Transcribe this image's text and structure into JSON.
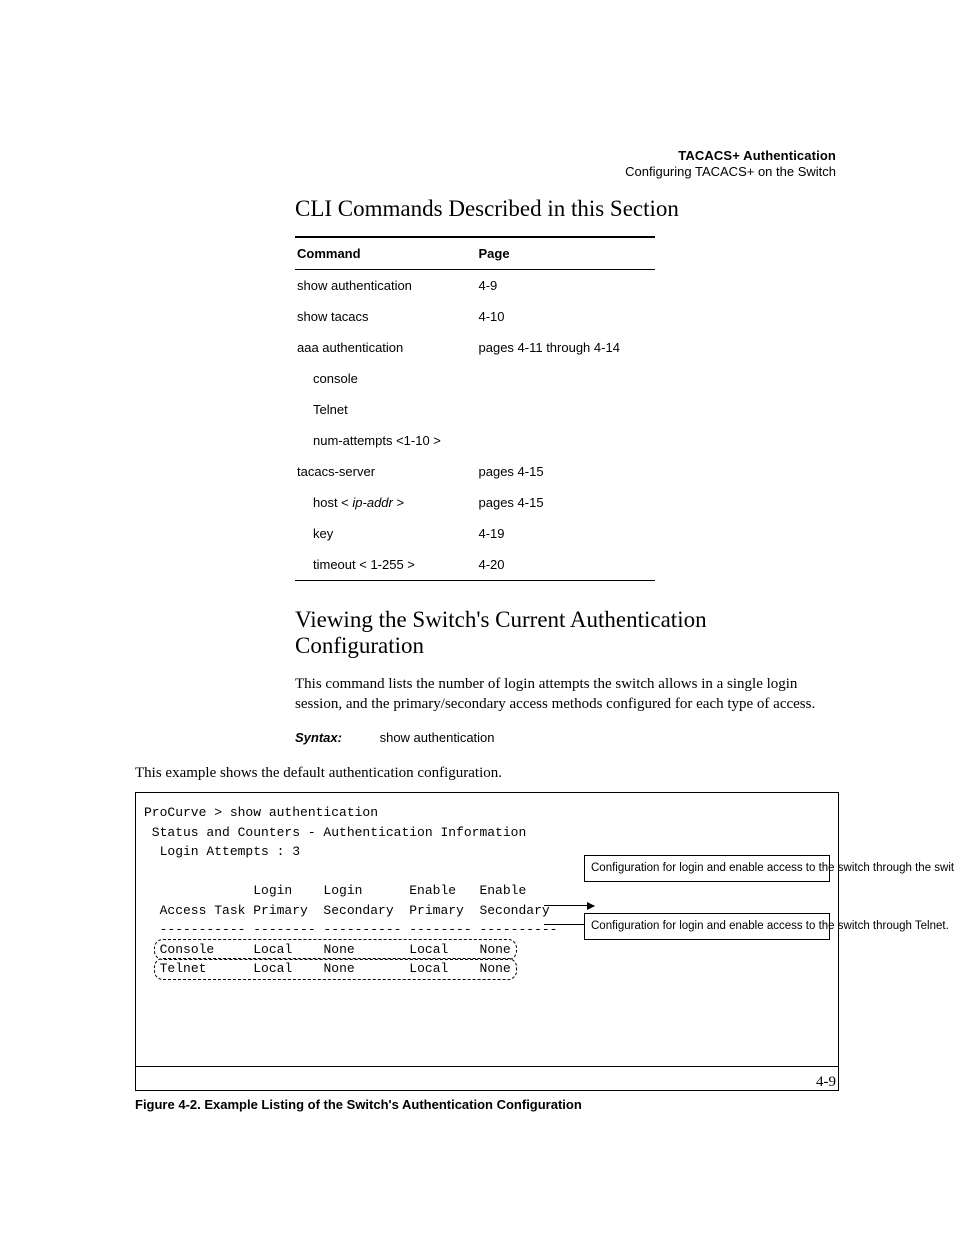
{
  "running_head": {
    "bold": "TACACS+ Authentication",
    "sub": "Configuring TACACS+ on the Switch"
  },
  "h_cli": "CLI Commands Described in this Section",
  "table": {
    "head": {
      "c0": "Command",
      "c1": "Page"
    },
    "rows": [
      {
        "c0": "show authentication",
        "c1": "4-9",
        "sub": 0
      },
      {
        "c0": "show tacacs",
        "c1": "4-10",
        "sub": 0
      },
      {
        "c0": "aaa authentication",
        "c1": "pages 4-11 through 4-14",
        "sub": 0
      },
      {
        "c0": "console",
        "c1": "",
        "sub": 1
      },
      {
        "c0": "Telnet",
        "c1": "",
        "sub": 1
      },
      {
        "c0": "num-attempts <1-10 >",
        "c1": "",
        "sub": 1
      },
      {
        "c0": "tacacs-server",
        "c1": "pages 4-15",
        "sub": 0
      },
      {
        "c0_pre": "host < ",
        "c0_it": "ip-addr",
        "c0_post": " >",
        "c1": "pages 4-15",
        "sub": 1,
        "it": 1
      },
      {
        "c0": "key",
        "c1": "4-19",
        "sub": 1
      },
      {
        "c0": "timeout < 1-255 >",
        "c1": "4-20",
        "sub": 1
      }
    ]
  },
  "h_view": "Viewing the Switch's Current Authentication Configuration",
  "para": "This command lists the number of login attempts the switch allows in a single login session, and the primary/secondary access methods configured for each type of access.",
  "syntax_label": "Syntax:",
  "syntax_value": "show authentication",
  "example_lead": "This example shows the default authentication configuration.",
  "terminal": {
    "l1": "ProCurve > show authentication",
    "l2": " Status and Counters - Authentication Information",
    "l3": "  Login Attempts : 3",
    "l4": "              Login    Login      Enable   Enable",
    "l5": "  Access Task Primary  Secondary  Primary  Secondary",
    "l6": "  ----------- -------- ---------- -------- ----------",
    "row1": {
      "task": "Console",
      "lp": "Local",
      "ls": "None",
      "ep": "Local",
      "es": "None"
    },
    "row2": {
      "task": "Telnet",
      "lp": "Local",
      "ls": "None",
      "ep": "Local",
      "es": "None"
    }
  },
  "callout1": "Configuration for login and enable access to the switch through the switch console port.",
  "callout2": "Configuration for login and enable access to the switch through Telnet.",
  "fig_caption": "Figure 4-2. Example Listing of the Switch's Authentication Configuration",
  "folio": "4-9"
}
